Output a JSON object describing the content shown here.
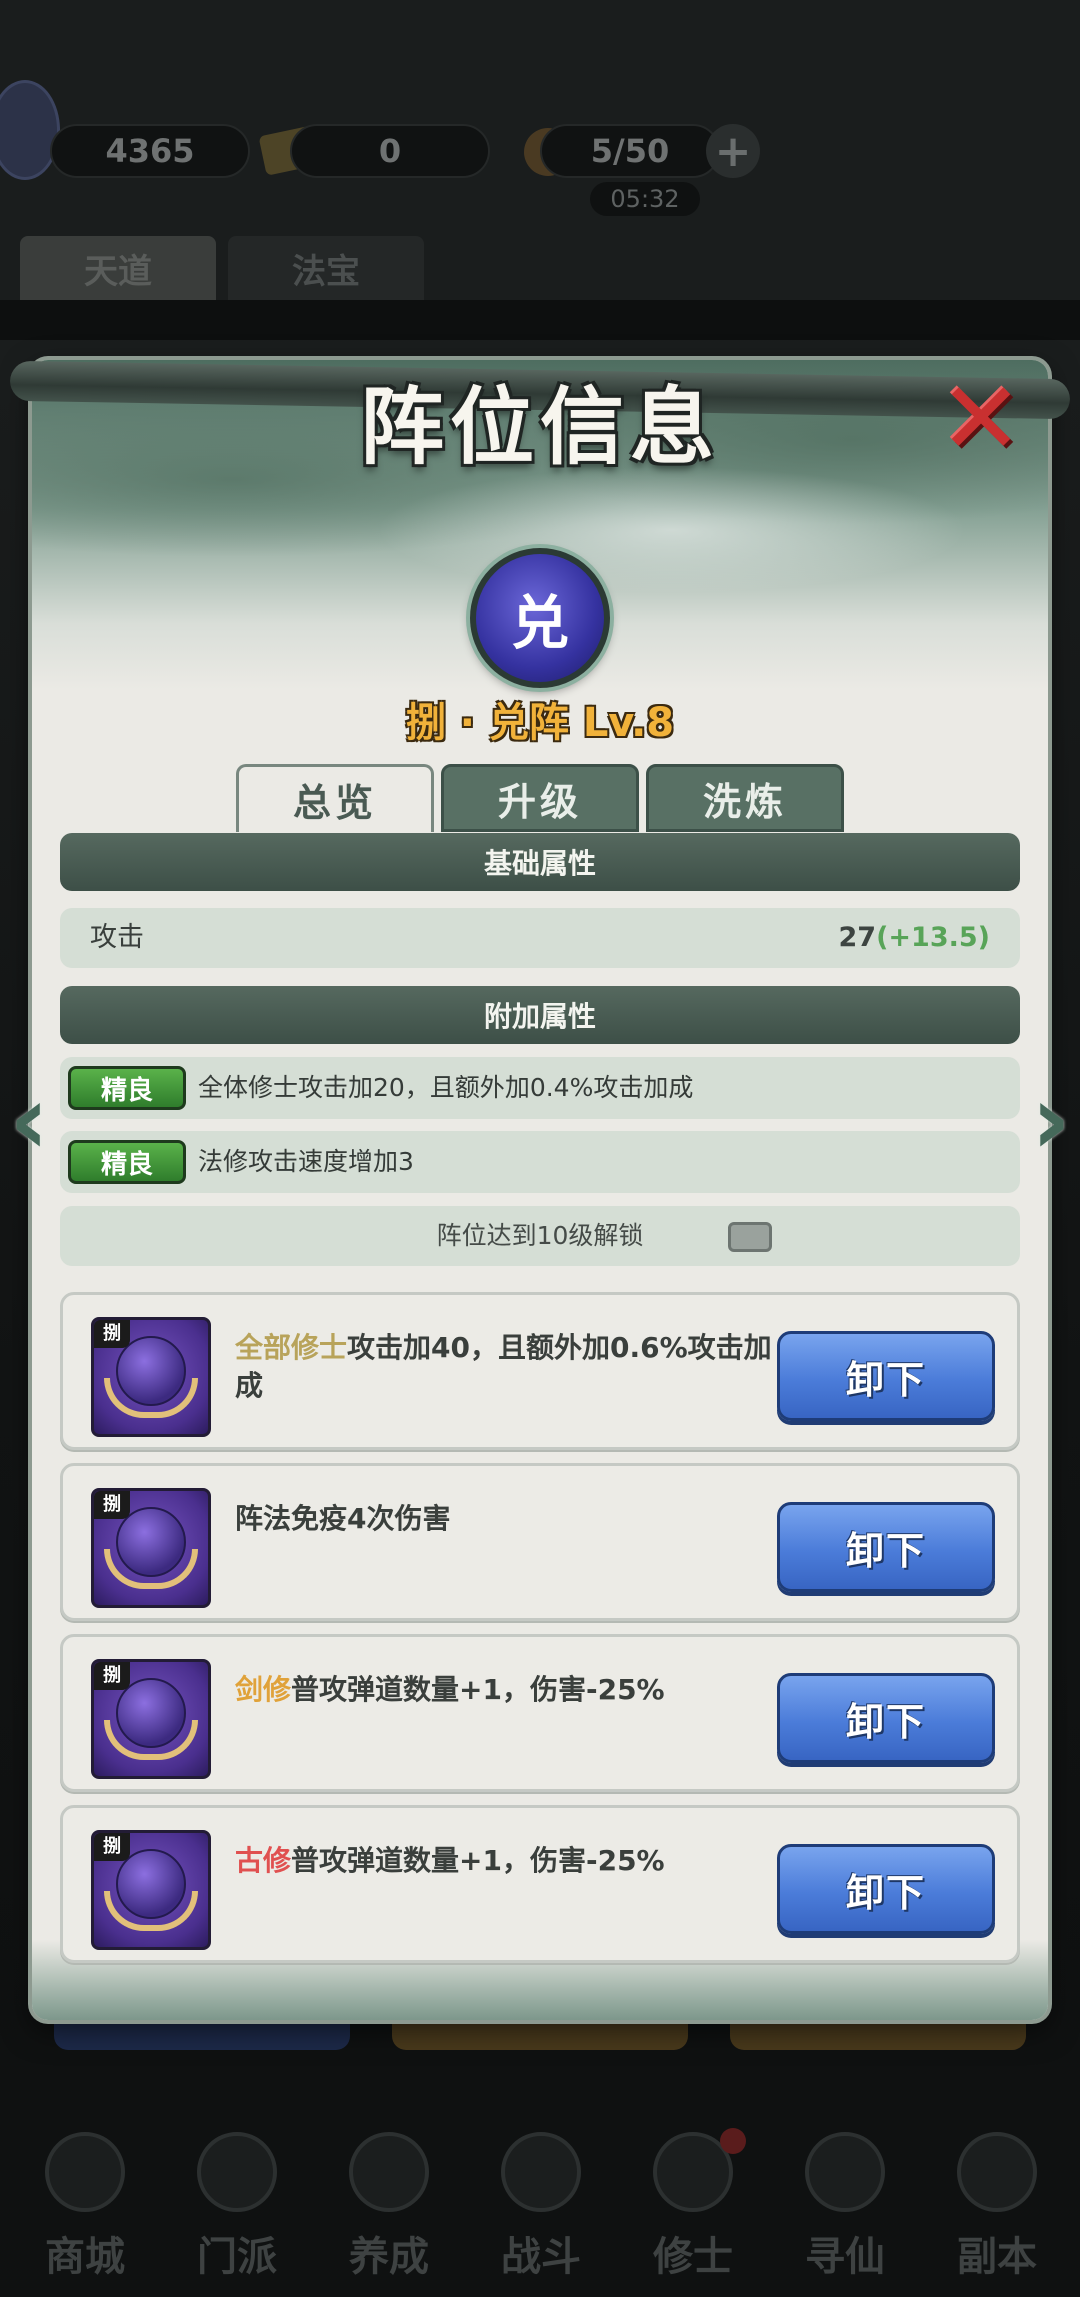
{
  "top_bar": {
    "currency_1": "4365",
    "currency_2": "0",
    "stamina": "5/50",
    "timer": "05:32",
    "plus": "+"
  },
  "bg_tabs": [
    "天道",
    "法宝"
  ],
  "bottom_nav": [
    "商城",
    "门派",
    "养成",
    "战斗",
    "修士",
    "寻仙",
    "副本"
  ],
  "modal": {
    "title": "阵位信息",
    "close": "✕",
    "emblem_char": "兑",
    "formation_name": "捌 · 兑阵 Lv.8",
    "tabs": [
      "总览",
      "升级",
      "洗炼"
    ],
    "base_section": "基础属性",
    "base_attrs": [
      {
        "name": "攻击",
        "value": "27",
        "bonus": "(+13.5)"
      }
    ],
    "extra_section": "附加属性",
    "extra_attrs": [
      {
        "tag": "精良",
        "text": "全体修士攻击加20，且额外加0.4%攻击加成"
      },
      {
        "tag": "精良",
        "text": "法修攻击速度增加3"
      }
    ],
    "locked_text": "阵位达到10级解锁",
    "arrows": {
      "left": "‹",
      "right": "›"
    },
    "equipment": [
      {
        "badge": "捌",
        "highlight": "全部修士",
        "highlight_color": "#b8a35a",
        "text": "攻击加40，且额外加0.6%攻击加成",
        "button": "卸下"
      },
      {
        "badge": "捌",
        "highlight": "",
        "highlight_color": "#3a3f3c",
        "text": "阵法免疫4次伤害",
        "button": "卸下"
      },
      {
        "badge": "捌",
        "highlight": "剑修",
        "highlight_color": "#e0a23a",
        "text": "普攻弹道数量+1，伤害-25%",
        "button": "卸下"
      },
      {
        "badge": "捌",
        "highlight": "古修",
        "highlight_color": "#e05050",
        "text": "普攻弹道数量+1，伤害-25%",
        "button": "卸下"
      }
    ]
  },
  "colors": {
    "panel_bg": "#ebeae5",
    "section_bar": "#4a5d54",
    "quality_green": "#4aa03e",
    "button_blue": "#4b7cd9",
    "bonus_green": "#58a458"
  }
}
